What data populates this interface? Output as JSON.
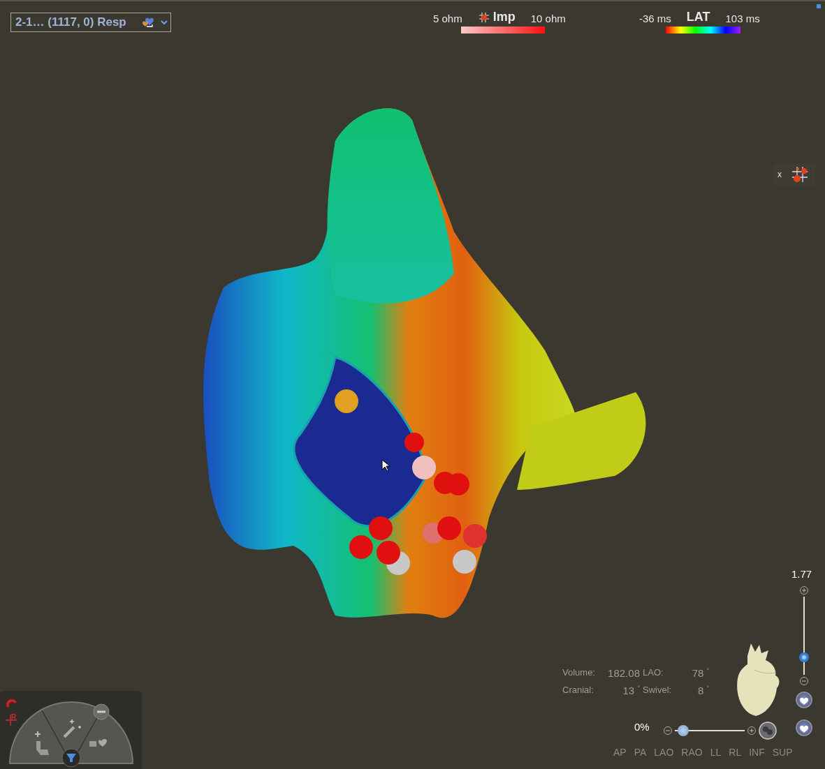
{
  "dropdown": {
    "value": "2-1… (1117, 0) Resp"
  },
  "legends": [
    {
      "kind": "impedance",
      "min": "5 ohm",
      "label": "Imp",
      "max": "10 ohm"
    },
    {
      "kind": "lat",
      "min": "-36 ms",
      "label": "LAT",
      "max": "103 ms"
    }
  ],
  "point_panel": {
    "close": "x"
  },
  "zoom": {
    "value": "1.77",
    "level": 0.22
  },
  "stats": [
    {
      "label": "Volume:",
      "value": "182.08"
    },
    {
      "label": "LAO:",
      "value": "78",
      "unit": "°"
    },
    {
      "label": "Cranial:",
      "value": "13",
      "unit": "°"
    },
    {
      "label": "Swivel:",
      "value": "8",
      "unit": "°"
    }
  ],
  "transparency": {
    "value": "0%",
    "level": 0.12
  },
  "views": [
    "AP",
    "PA",
    "LAO",
    "RAO",
    "LL",
    "RL",
    "INF",
    "SUP"
  ],
  "tool_wheel": {
    "reference_label": "R"
  }
}
